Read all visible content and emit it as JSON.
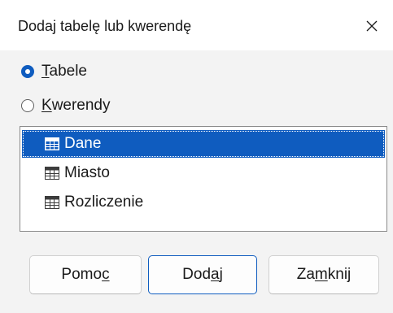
{
  "dialog": {
    "title": "Dodaj tabelę lub kwerendę",
    "accent_color": "#0f5cbf"
  },
  "close_icon": "close-icon",
  "radios": [
    {
      "pre": "",
      "ul": "T",
      "post": "abele",
      "checked": true
    },
    {
      "pre": "",
      "ul": "K",
      "post": "werendy",
      "checked": false
    }
  ],
  "list": {
    "items": [
      {
        "label": "Dane",
        "icon": "table-icon",
        "selected": true
      },
      {
        "label": "Miasto",
        "icon": "table-icon",
        "selected": false
      },
      {
        "label": "Rozliczenie",
        "icon": "table-icon",
        "selected": false
      }
    ]
  },
  "buttons": {
    "help": {
      "pre": "Pomo",
      "ul": "c",
      "post": ""
    },
    "add": {
      "pre": "Dod",
      "ul": "a",
      "post": "j"
    },
    "close": {
      "pre": "Za",
      "ul": "m",
      "post": "knij"
    }
  }
}
